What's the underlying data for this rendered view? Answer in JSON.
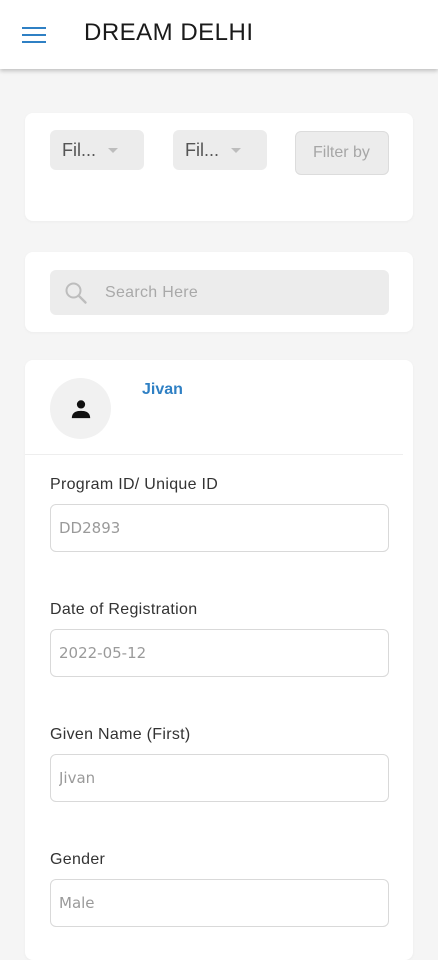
{
  "header": {
    "title": "DREAM DELHI",
    "menu_icon": "menu-icon",
    "accent_color": "#2f80c4"
  },
  "filters": {
    "dropdown_1": {
      "label": "Fil..."
    },
    "dropdown_2": {
      "label": "Fil..."
    },
    "text_filter": {
      "placeholder": "Filter by"
    }
  },
  "search": {
    "placeholder": "Search Here",
    "icon": "search-icon"
  },
  "beneficiary": {
    "avatar_icon": "person-icon",
    "name": "Jivan",
    "fields": [
      {
        "label": "Program ID/ Unique ID",
        "value": "DD2893"
      },
      {
        "label": "Date of Registration",
        "value": "2022-05-12"
      },
      {
        "label": "Given Name (First)",
        "value": "Jivan"
      },
      {
        "label": "Gender",
        "value": "Male"
      }
    ]
  }
}
